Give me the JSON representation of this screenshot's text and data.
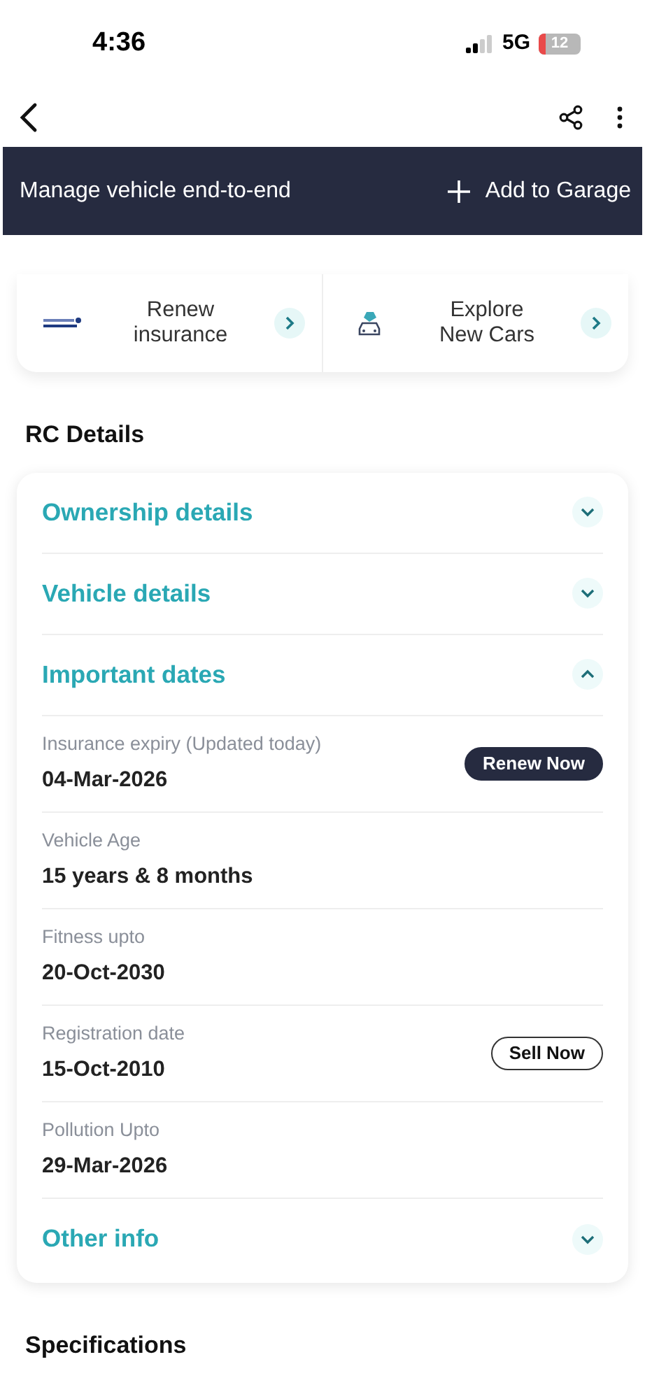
{
  "status_bar": {
    "time": "4:36",
    "network": "5G",
    "battery": "12"
  },
  "banner": {
    "title": "Manage vehicle end-to-end",
    "action": "Add to Garage"
  },
  "quick_links": [
    {
      "label": "Renew insurance",
      "kind": "insurance"
    },
    {
      "label": "Explore New Cars",
      "kind": "cars"
    }
  ],
  "rc_title": "RC Details",
  "sections": [
    {
      "title": "Ownership details",
      "expanded": false
    },
    {
      "title": "Vehicle details",
      "expanded": false
    },
    {
      "title": "Important dates",
      "expanded": true,
      "fields": [
        {
          "label": "Insurance expiry (Updated today)",
          "value": "04-Mar-2026",
          "action": {
            "label": "Renew Now",
            "kind": "filled"
          }
        },
        {
          "label": "Vehicle Age",
          "value": "15 years & 8 months"
        },
        {
          "label": "Fitness upto",
          "value": "20-Oct-2030"
        },
        {
          "label": "Registration date",
          "value": "15-Oct-2010",
          "action": {
            "label": "Sell Now",
            "kind": "outline"
          }
        },
        {
          "label": "Pollution Upto",
          "value": "29-Mar-2026"
        }
      ]
    },
    {
      "title": "Other info",
      "expanded": false
    }
  ],
  "specifications_title": "Specifications"
}
